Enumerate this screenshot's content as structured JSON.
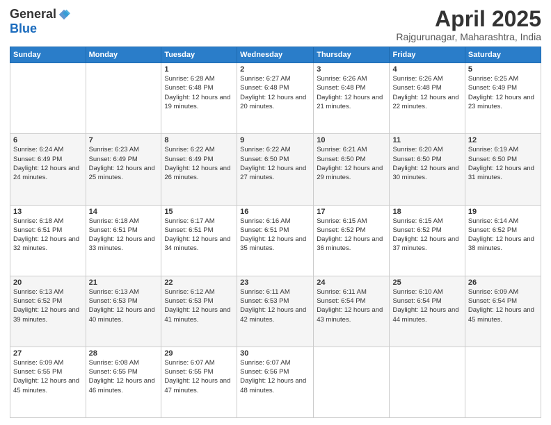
{
  "logo": {
    "general": "General",
    "blue": "Blue"
  },
  "title": "April 2025",
  "location": "Rajgurunagar, Maharashtra, India",
  "days_of_week": [
    "Sunday",
    "Monday",
    "Tuesday",
    "Wednesday",
    "Thursday",
    "Friday",
    "Saturday"
  ],
  "weeks": [
    [
      null,
      null,
      {
        "day": 1,
        "sunrise": "6:28 AM",
        "sunset": "6:48 PM",
        "daylight": "12 hours and 19 minutes."
      },
      {
        "day": 2,
        "sunrise": "6:27 AM",
        "sunset": "6:48 PM",
        "daylight": "12 hours and 20 minutes."
      },
      {
        "day": 3,
        "sunrise": "6:26 AM",
        "sunset": "6:48 PM",
        "daylight": "12 hours and 21 minutes."
      },
      {
        "day": 4,
        "sunrise": "6:26 AM",
        "sunset": "6:48 PM",
        "daylight": "12 hours and 22 minutes."
      },
      {
        "day": 5,
        "sunrise": "6:25 AM",
        "sunset": "6:49 PM",
        "daylight": "12 hours and 23 minutes."
      }
    ],
    [
      {
        "day": 6,
        "sunrise": "6:24 AM",
        "sunset": "6:49 PM",
        "daylight": "12 hours and 24 minutes."
      },
      {
        "day": 7,
        "sunrise": "6:23 AM",
        "sunset": "6:49 PM",
        "daylight": "12 hours and 25 minutes."
      },
      {
        "day": 8,
        "sunrise": "6:22 AM",
        "sunset": "6:49 PM",
        "daylight": "12 hours and 26 minutes."
      },
      {
        "day": 9,
        "sunrise": "6:22 AM",
        "sunset": "6:50 PM",
        "daylight": "12 hours and 27 minutes."
      },
      {
        "day": 10,
        "sunrise": "6:21 AM",
        "sunset": "6:50 PM",
        "daylight": "12 hours and 29 minutes."
      },
      {
        "day": 11,
        "sunrise": "6:20 AM",
        "sunset": "6:50 PM",
        "daylight": "12 hours and 30 minutes."
      },
      {
        "day": 12,
        "sunrise": "6:19 AM",
        "sunset": "6:50 PM",
        "daylight": "12 hours and 31 minutes."
      }
    ],
    [
      {
        "day": 13,
        "sunrise": "6:18 AM",
        "sunset": "6:51 PM",
        "daylight": "12 hours and 32 minutes."
      },
      {
        "day": 14,
        "sunrise": "6:18 AM",
        "sunset": "6:51 PM",
        "daylight": "12 hours and 33 minutes."
      },
      {
        "day": 15,
        "sunrise": "6:17 AM",
        "sunset": "6:51 PM",
        "daylight": "12 hours and 34 minutes."
      },
      {
        "day": 16,
        "sunrise": "6:16 AM",
        "sunset": "6:51 PM",
        "daylight": "12 hours and 35 minutes."
      },
      {
        "day": 17,
        "sunrise": "6:15 AM",
        "sunset": "6:52 PM",
        "daylight": "12 hours and 36 minutes."
      },
      {
        "day": 18,
        "sunrise": "6:15 AM",
        "sunset": "6:52 PM",
        "daylight": "12 hours and 37 minutes."
      },
      {
        "day": 19,
        "sunrise": "6:14 AM",
        "sunset": "6:52 PM",
        "daylight": "12 hours and 38 minutes."
      }
    ],
    [
      {
        "day": 20,
        "sunrise": "6:13 AM",
        "sunset": "6:52 PM",
        "daylight": "12 hours and 39 minutes."
      },
      {
        "day": 21,
        "sunrise": "6:13 AM",
        "sunset": "6:53 PM",
        "daylight": "12 hours and 40 minutes."
      },
      {
        "day": 22,
        "sunrise": "6:12 AM",
        "sunset": "6:53 PM",
        "daylight": "12 hours and 41 minutes."
      },
      {
        "day": 23,
        "sunrise": "6:11 AM",
        "sunset": "6:53 PM",
        "daylight": "12 hours and 42 minutes."
      },
      {
        "day": 24,
        "sunrise": "6:11 AM",
        "sunset": "6:54 PM",
        "daylight": "12 hours and 43 minutes."
      },
      {
        "day": 25,
        "sunrise": "6:10 AM",
        "sunset": "6:54 PM",
        "daylight": "12 hours and 44 minutes."
      },
      {
        "day": 26,
        "sunrise": "6:09 AM",
        "sunset": "6:54 PM",
        "daylight": "12 hours and 45 minutes."
      }
    ],
    [
      {
        "day": 27,
        "sunrise": "6:09 AM",
        "sunset": "6:55 PM",
        "daylight": "12 hours and 45 minutes."
      },
      {
        "day": 28,
        "sunrise": "6:08 AM",
        "sunset": "6:55 PM",
        "daylight": "12 hours and 46 minutes."
      },
      {
        "day": 29,
        "sunrise": "6:07 AM",
        "sunset": "6:55 PM",
        "daylight": "12 hours and 47 minutes."
      },
      {
        "day": 30,
        "sunrise": "6:07 AM",
        "sunset": "6:56 PM",
        "daylight": "12 hours and 48 minutes."
      },
      null,
      null,
      null
    ]
  ],
  "labels": {
    "sunrise_prefix": "Sunrise: ",
    "sunset_prefix": "Sunset: ",
    "daylight_prefix": "Daylight: "
  }
}
